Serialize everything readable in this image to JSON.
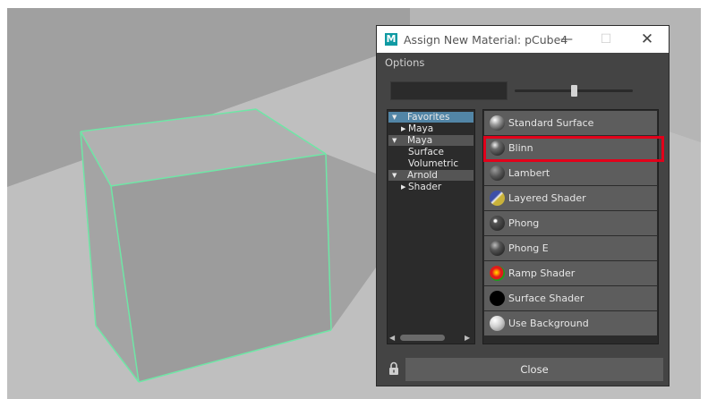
{
  "dialog": {
    "logo_letter": "M",
    "title": "Assign New Material: pCube4",
    "controls": {
      "minimize": "—",
      "maximize": "☐",
      "close": "✕"
    },
    "menu": {
      "options": "Options"
    },
    "filter": {
      "value": ""
    },
    "icon_size_slider": {
      "value_fraction": 0.5
    },
    "close_button": "Close"
  },
  "tree": [
    {
      "label": "Favorites",
      "state": "expanded",
      "level": 0,
      "selected": true
    },
    {
      "label": "Maya",
      "state": "collapsed",
      "level": 1
    },
    {
      "label": "Maya",
      "state": "expanded",
      "level": 0,
      "header": true
    },
    {
      "label": "Surface",
      "state": "none",
      "level": 1
    },
    {
      "label": "Volumetric",
      "state": "none",
      "level": 1
    },
    {
      "label": "Arnold",
      "state": "expanded",
      "level": 0,
      "header": true
    },
    {
      "label": "Shader",
      "state": "collapsed",
      "level": 1
    }
  ],
  "materials": [
    {
      "label": "Standard Surface",
      "icon": "standard-surface-swatch"
    },
    {
      "label": "Blinn",
      "icon": "blinn-swatch",
      "highlighted": true
    },
    {
      "label": "Lambert",
      "icon": "lambert-swatch"
    },
    {
      "label": "Layered Shader",
      "icon": "layered-shader-swatch"
    },
    {
      "label": "Phong",
      "icon": "phong-swatch"
    },
    {
      "label": "Phong E",
      "icon": "phong-e-swatch"
    },
    {
      "label": "Ramp Shader",
      "icon": "ramp-shader-swatch"
    },
    {
      "label": "Surface Shader",
      "icon": "surface-shader-swatch"
    },
    {
      "label": "Use Background",
      "icon": "use-background-swatch"
    }
  ],
  "colors": {
    "dialog_bg": "#444444",
    "selection": "#5285a6",
    "highlight_box": "#e2001a",
    "wireframe": "#6fe6a6",
    "maya_logo": "#0f9aa3"
  }
}
